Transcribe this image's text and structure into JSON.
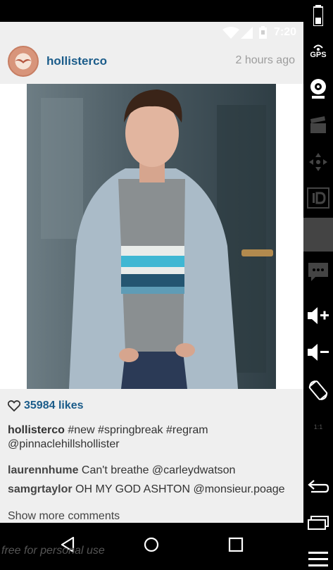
{
  "status_bar": {
    "time": "7:20"
  },
  "post": {
    "username": "hollisterco",
    "time_ago": "2 hours ago",
    "likes": "35984 likes",
    "caption": {
      "user": "hollisterco",
      "text": " #new #springbreak #regram @pinnaclehillshollister"
    },
    "comments": [
      {
        "user": "laurennhume",
        "text": " Can't breathe @carleydwatson"
      },
      {
        "user": "samgrtaylor",
        "text": " OH MY GOD ASHTON @monsieur.poage"
      }
    ],
    "show_more": "Show more comments"
  },
  "watermark": "free for personal use",
  "side_panel": {
    "gps": "GPS",
    "one_to_one": "1:1"
  },
  "colors": {
    "link": "#1b5c8a",
    "background": "#efefef"
  },
  "icons": [
    "battery-icon",
    "wifi-icon",
    "signal-icon",
    "heart-icon",
    "back-icon",
    "home-icon",
    "recents-icon",
    "camera-icon",
    "film-icon",
    "dpad-icon",
    "id-icon",
    "sms-icon",
    "volume-up-icon",
    "volume-down-icon",
    "rotate-icon",
    "menu-icon"
  ]
}
